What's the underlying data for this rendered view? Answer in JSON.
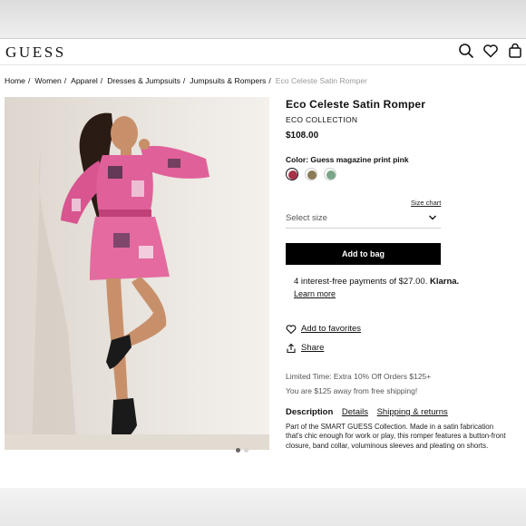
{
  "brand": {
    "logo": "GUESS"
  },
  "header": {
    "icons": [
      "search-icon",
      "heart-icon",
      "shopping-bag-icon"
    ]
  },
  "breadcrumb": {
    "items": [
      "Home",
      "Women",
      "Apparel",
      "Dresses & Jumpsuits",
      "Jumpsuits & Rompers"
    ],
    "current": "Eco Celeste Satin Romper",
    "separator": "/"
  },
  "product": {
    "title": "Eco Celeste Satin Romper",
    "collection": "ECO COLLECTION",
    "price": "$108.00",
    "color_label": "Color: Guess magazine print pink",
    "swatches": [
      {
        "name": "magazine-print-pink",
        "color": "#a8324a",
        "selected": true
      },
      {
        "name": "magazine-print-neutral",
        "color": "#8a7a55",
        "selected": false
      },
      {
        "name": "magazine-print-green",
        "color": "#7aa588",
        "selected": false
      }
    ],
    "size_chart": "Size chart",
    "size_placeholder": "Select size",
    "add_to_bag": "Add to bag",
    "klarna": {
      "text": "4 interest-free payments of $27.00.",
      "brand": "Klarna.",
      "learn_more": "Learn more"
    },
    "favorites": "Add to favorites",
    "share": "Share",
    "promo": "Limited Time: Extra 10% Off Orders $125+",
    "shipping": "You are $125 away from free shipping!",
    "tabs": [
      "Description",
      "Details",
      "Shipping & returns"
    ],
    "active_tab": "Description",
    "description": "Part of the SMART GUESS Collection. Made in a satin fabrication that's chic enough for work or play, this romper features a button-front closure, band collar, voluminous sleeves and pleating on shorts."
  },
  "gallery": {
    "dots": 2,
    "active_dot": 0,
    "image_alt": "Model wearing pink magazine print satin romper"
  },
  "colors": {
    "accent": "#000000",
    "muted_text": "#555555",
    "breadcrumb_current": "#9a9a9a",
    "romper_pink": "#e0609a",
    "background": "#ece8e3"
  }
}
